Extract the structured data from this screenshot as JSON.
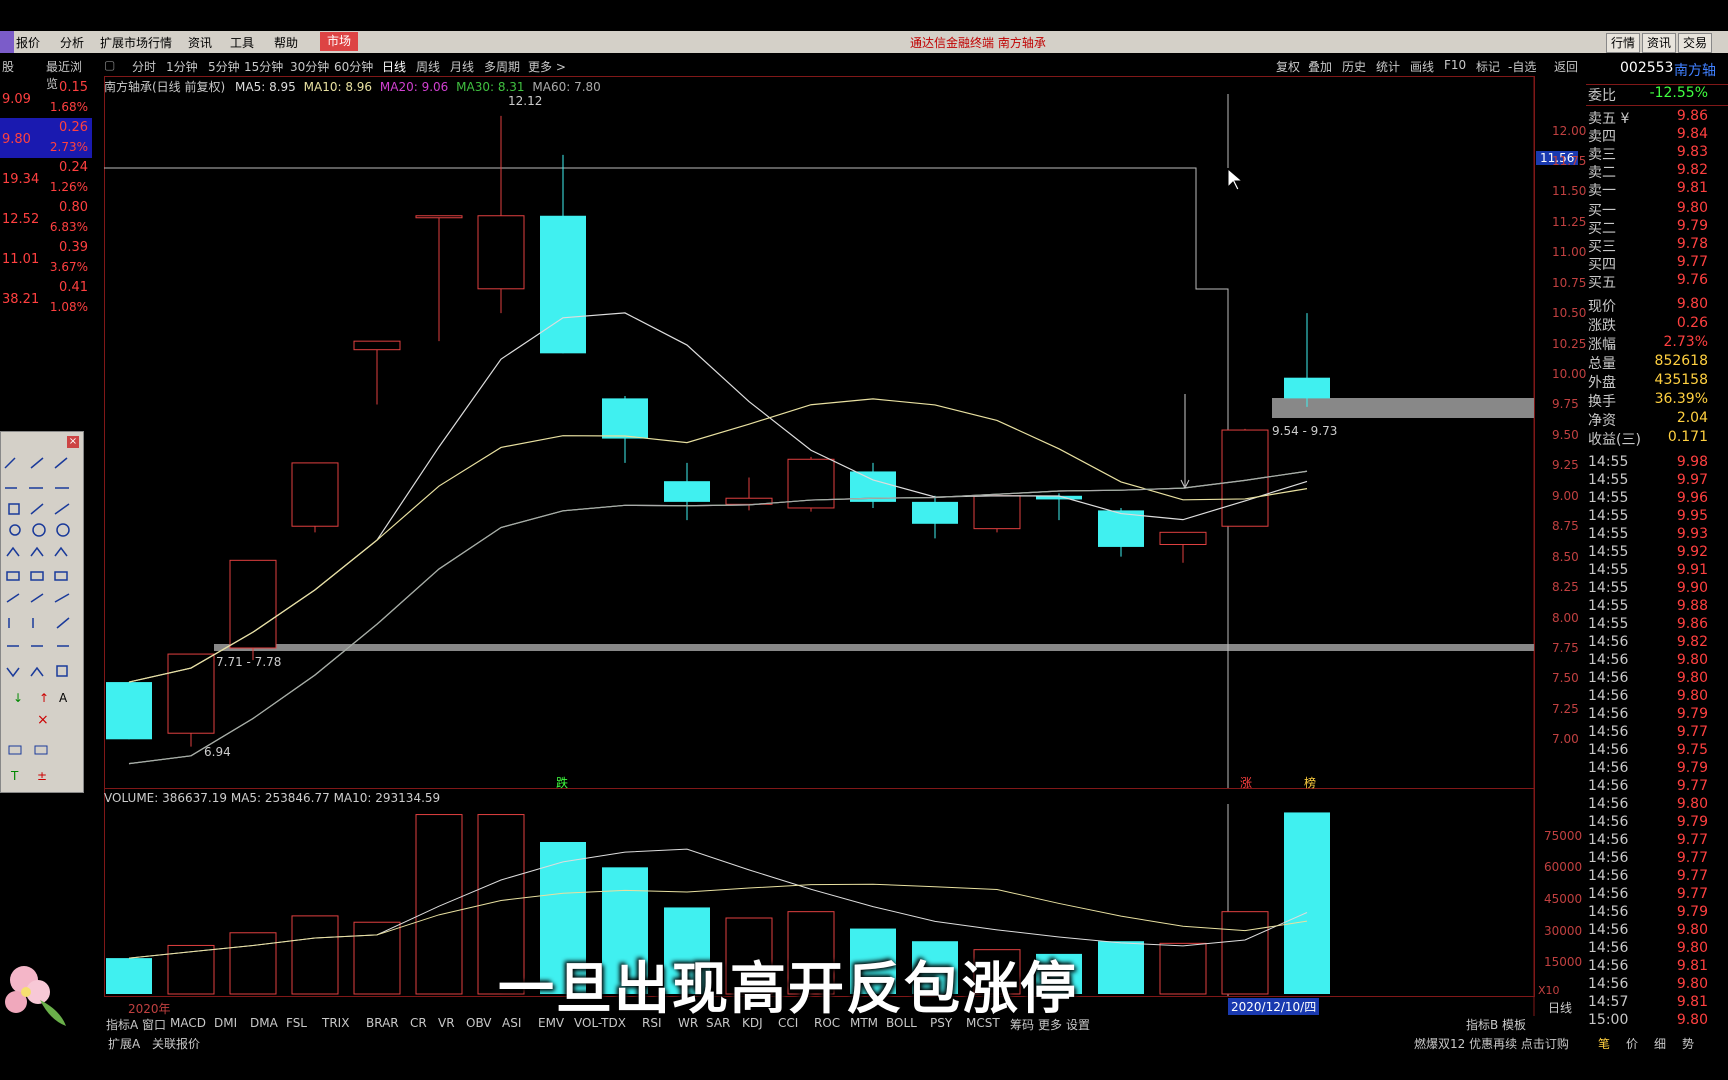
{
  "window": {
    "title": "通达信金融终端  南方轴承",
    "menus": [
      "报价",
      "分析",
      "扩展市场行情",
      "资讯",
      "工具",
      "帮助"
    ],
    "market_button": "市场",
    "right_buttons": [
      "行情",
      "资讯",
      "交易"
    ]
  },
  "toolbar": {
    "periods": [
      "分时",
      "1分钟",
      "5分钟",
      "15分钟",
      "30分钟",
      "60分钟",
      "日线",
      "周线",
      "月线",
      "多周期",
      "更多 >"
    ],
    "active_period": "日线",
    "right_items": [
      "复权",
      "叠加",
      "历史",
      "统计",
      "画线",
      "F10",
      "标记",
      "-自选",
      "返回"
    ]
  },
  "left_panel": {
    "tab_label": "最近浏览",
    "rows": [
      {
        "price": "9.09",
        "change": "0.15",
        "pct": "1.68%"
      },
      {
        "price": "9.80",
        "change": "0.26",
        "pct": "2.73%"
      },
      {
        "price": "19.34",
        "change": "0.24",
        "pct": "1.26%"
      },
      {
        "price": "12.52",
        "change": "0.80",
        "pct": "6.83%"
      },
      {
        "price": "11.01",
        "change": "0.39",
        "pct": "3.67%"
      },
      {
        "price": "38.21",
        "change": "0.41",
        "pct": "1.08%"
      }
    ]
  },
  "main_chart": {
    "legend_title": "南方轴承(日线 前复权)",
    "ma5": "MA5: 8.95",
    "ma10": "MA10: 8.96",
    "ma20": "MA20: 9.06",
    "ma30": "MA30: 8.31",
    "ma60": "MA60: 7.80",
    "high_label": "12.12",
    "low_label": "6.94",
    "zone_low_label": "7.71 - 7.78",
    "zone_high_label": "9.54 - 9.73",
    "crosshair_price": "11.56",
    "marker_down": "跌",
    "marker_up": "涨",
    "marker_board": "榜",
    "date_label": "2020年",
    "cursor_date": "2020/12/10/四",
    "period_label": "日线",
    "y_ticks": [
      "12.00",
      "11.75",
      "11.50",
      "11.25",
      "11.00",
      "10.75",
      "10.50",
      "10.25",
      "10.00",
      "9.75",
      "9.50",
      "9.25",
      "9.00",
      "8.75",
      "8.50",
      "8.25",
      "8.00",
      "7.75",
      "7.50",
      "7.25",
      "7.00"
    ],
    "vol_legend": "VOLUME: 386637.19  MA5: 253846.77  MA10: 293134.59",
    "vol_ticks": [
      "75000",
      "60000",
      "45000",
      "30000",
      "15000"
    ],
    "vol_unit": "X10"
  },
  "chart_data": {
    "type": "candlestick",
    "title": "南方轴承(日线 前复权)",
    "candles": [
      {
        "o": 7.0,
        "c": 7.47,
        "h": 7.47,
        "l": 7.0,
        "up": false
      },
      {
        "o": 7.05,
        "c": 7.7,
        "h": 7.7,
        "l": 6.94,
        "up": true
      },
      {
        "o": 7.75,
        "c": 8.47,
        "h": 8.47,
        "l": 7.65,
        "up": true
      },
      {
        "o": 8.75,
        "c": 9.27,
        "h": 9.27,
        "l": 8.7,
        "up": true
      },
      {
        "o": 10.2,
        "c": 10.27,
        "h": 10.27,
        "l": 9.75,
        "up": true
      },
      {
        "o": 11.3,
        "c": 11.3,
        "h": 11.3,
        "l": 10.27,
        "up": true
      },
      {
        "o": 10.7,
        "c": 11.3,
        "h": 12.12,
        "l": 10.5,
        "up": true
      },
      {
        "o": 11.3,
        "c": 10.17,
        "h": 11.8,
        "l": 10.17,
        "up": false
      },
      {
        "o": 9.8,
        "c": 9.47,
        "h": 9.82,
        "l": 9.27,
        "up": false
      },
      {
        "o": 9.12,
        "c": 8.95,
        "h": 9.27,
        "l": 8.8,
        "up": false
      },
      {
        "o": 8.93,
        "c": 8.98,
        "h": 9.15,
        "l": 8.88,
        "up": true
      },
      {
        "o": 8.9,
        "c": 9.3,
        "h": 9.32,
        "l": 8.87,
        "up": true
      },
      {
        "o": 9.2,
        "c": 8.95,
        "h": 9.27,
        "l": 8.9,
        "up": false
      },
      {
        "o": 8.95,
        "c": 8.77,
        "h": 9.0,
        "l": 8.65,
        "up": false
      },
      {
        "o": 8.73,
        "c": 9.0,
        "h": 9.0,
        "l": 8.7,
        "up": true
      },
      {
        "o": 9.0,
        "c": 8.97,
        "h": 9.02,
        "l": 8.8,
        "up": false
      },
      {
        "o": 8.88,
        "c": 8.58,
        "h": 8.9,
        "l": 8.5,
        "up": false
      },
      {
        "o": 8.6,
        "c": 8.7,
        "h": 8.7,
        "l": 8.45,
        "up": true
      },
      {
        "o": 8.75,
        "c": 9.54,
        "h": 9.55,
        "l": 8.75,
        "up": true
      },
      {
        "o": 9.97,
        "c": 9.8,
        "h": 10.5,
        "l": 9.73,
        "up": false
      }
    ],
    "volumes": [
      17000,
      23000,
      29000,
      37000,
      34000,
      85000,
      85000,
      72000,
      60000,
      41000,
      36000,
      39000,
      31000,
      25000,
      21000,
      19000,
      25000,
      24000,
      39000,
      86000
    ],
    "ylim": [
      6.6,
      12.3
    ],
    "vol_ylim": [
      0,
      90000
    ]
  },
  "right_panel": {
    "code": "002553",
    "name": "南方轴",
    "weibi_label": "委比",
    "weibi_value": "-12.55%",
    "sell": [
      {
        "label": "卖五 ¥",
        "price": "9.86"
      },
      {
        "label": "卖四",
        "price": "9.84"
      },
      {
        "label": "卖三",
        "price": "9.83"
      },
      {
        "label": "卖二",
        "price": "9.82"
      },
      {
        "label": "卖一",
        "price": "9.81"
      }
    ],
    "buy": [
      {
        "label": "买一",
        "price": "9.80"
      },
      {
        "label": "买二",
        "price": "9.79"
      },
      {
        "label": "买三",
        "price": "9.78"
      },
      {
        "label": "买四",
        "price": "9.77"
      },
      {
        "label": "买五",
        "price": "9.76"
      }
    ],
    "stats": [
      {
        "label": "现价",
        "value": "9.80"
      },
      {
        "label": "涨跌",
        "value": "0.26"
      },
      {
        "label": "涨幅",
        "value": "2.73%"
      },
      {
        "label": "总量",
        "value": "852618"
      },
      {
        "label": "外盘",
        "value": "435158"
      },
      {
        "label": "换手",
        "value": "36.39%"
      },
      {
        "label": "净资",
        "value": "2.04"
      },
      {
        "label": "收益(三)",
        "value": "0.171"
      }
    ],
    "ticks": [
      {
        "t": "14:55",
        "p": "9.98"
      },
      {
        "t": "14:55",
        "p": "9.97"
      },
      {
        "t": "14:55",
        "p": "9.96"
      },
      {
        "t": "14:55",
        "p": "9.95"
      },
      {
        "t": "14:55",
        "p": "9.93"
      },
      {
        "t": "14:55",
        "p": "9.92"
      },
      {
        "t": "14:55",
        "p": "9.91"
      },
      {
        "t": "14:55",
        "p": "9.90"
      },
      {
        "t": "14:55",
        "p": "9.88"
      },
      {
        "t": "14:55",
        "p": "9.86"
      },
      {
        "t": "14:56",
        "p": "9.82"
      },
      {
        "t": "14:56",
        "p": "9.80"
      },
      {
        "t": "14:56",
        "p": "9.80"
      },
      {
        "t": "14:56",
        "p": "9.80"
      },
      {
        "t": "14:56",
        "p": "9.79"
      },
      {
        "t": "14:56",
        "p": "9.77"
      },
      {
        "t": "14:56",
        "p": "9.75"
      },
      {
        "t": "14:56",
        "p": "9.79"
      },
      {
        "t": "14:56",
        "p": "9.77"
      },
      {
        "t": "14:56",
        "p": "9.80"
      },
      {
        "t": "14:56",
        "p": "9.79"
      },
      {
        "t": "14:56",
        "p": "9.77"
      },
      {
        "t": "14:56",
        "p": "9.77"
      },
      {
        "t": "14:56",
        "p": "9.77"
      },
      {
        "t": "14:56",
        "p": "9.77"
      },
      {
        "t": "14:56",
        "p": "9.79"
      },
      {
        "t": "14:56",
        "p": "9.80"
      },
      {
        "t": "14:56",
        "p": "9.80"
      },
      {
        "t": "14:56",
        "p": "9.81"
      },
      {
        "t": "14:56",
        "p": "9.80"
      },
      {
        "t": "14:57",
        "p": "9.81"
      },
      {
        "t": "15:00",
        "p": "9.80"
      }
    ]
  },
  "indicator_tabs": [
    "指标A",
    "窗口",
    "MACD",
    "DMI",
    "DMA",
    "FSL",
    "TRIX",
    "BRAR",
    "CR",
    "VR",
    "OBV",
    "ASI",
    "EMV",
    "VOL-TDX",
    "RSI",
    "WR",
    "SAR",
    "KDJ",
    "CCI",
    "ROC",
    "MTM",
    "BOLL",
    "PSY",
    "MCST",
    "筹码",
    "更多",
    "设置"
  ],
  "indicator_right": "指标B  模板",
  "status": {
    "left": [
      "扩展A",
      "关联报价"
    ],
    "ad": "燃爆双12 优惠再续 点击订购",
    "right_tabs": [
      "笔",
      "价",
      "细",
      "势"
    ]
  },
  "subtitle": "一旦出现高开反包涨停"
}
